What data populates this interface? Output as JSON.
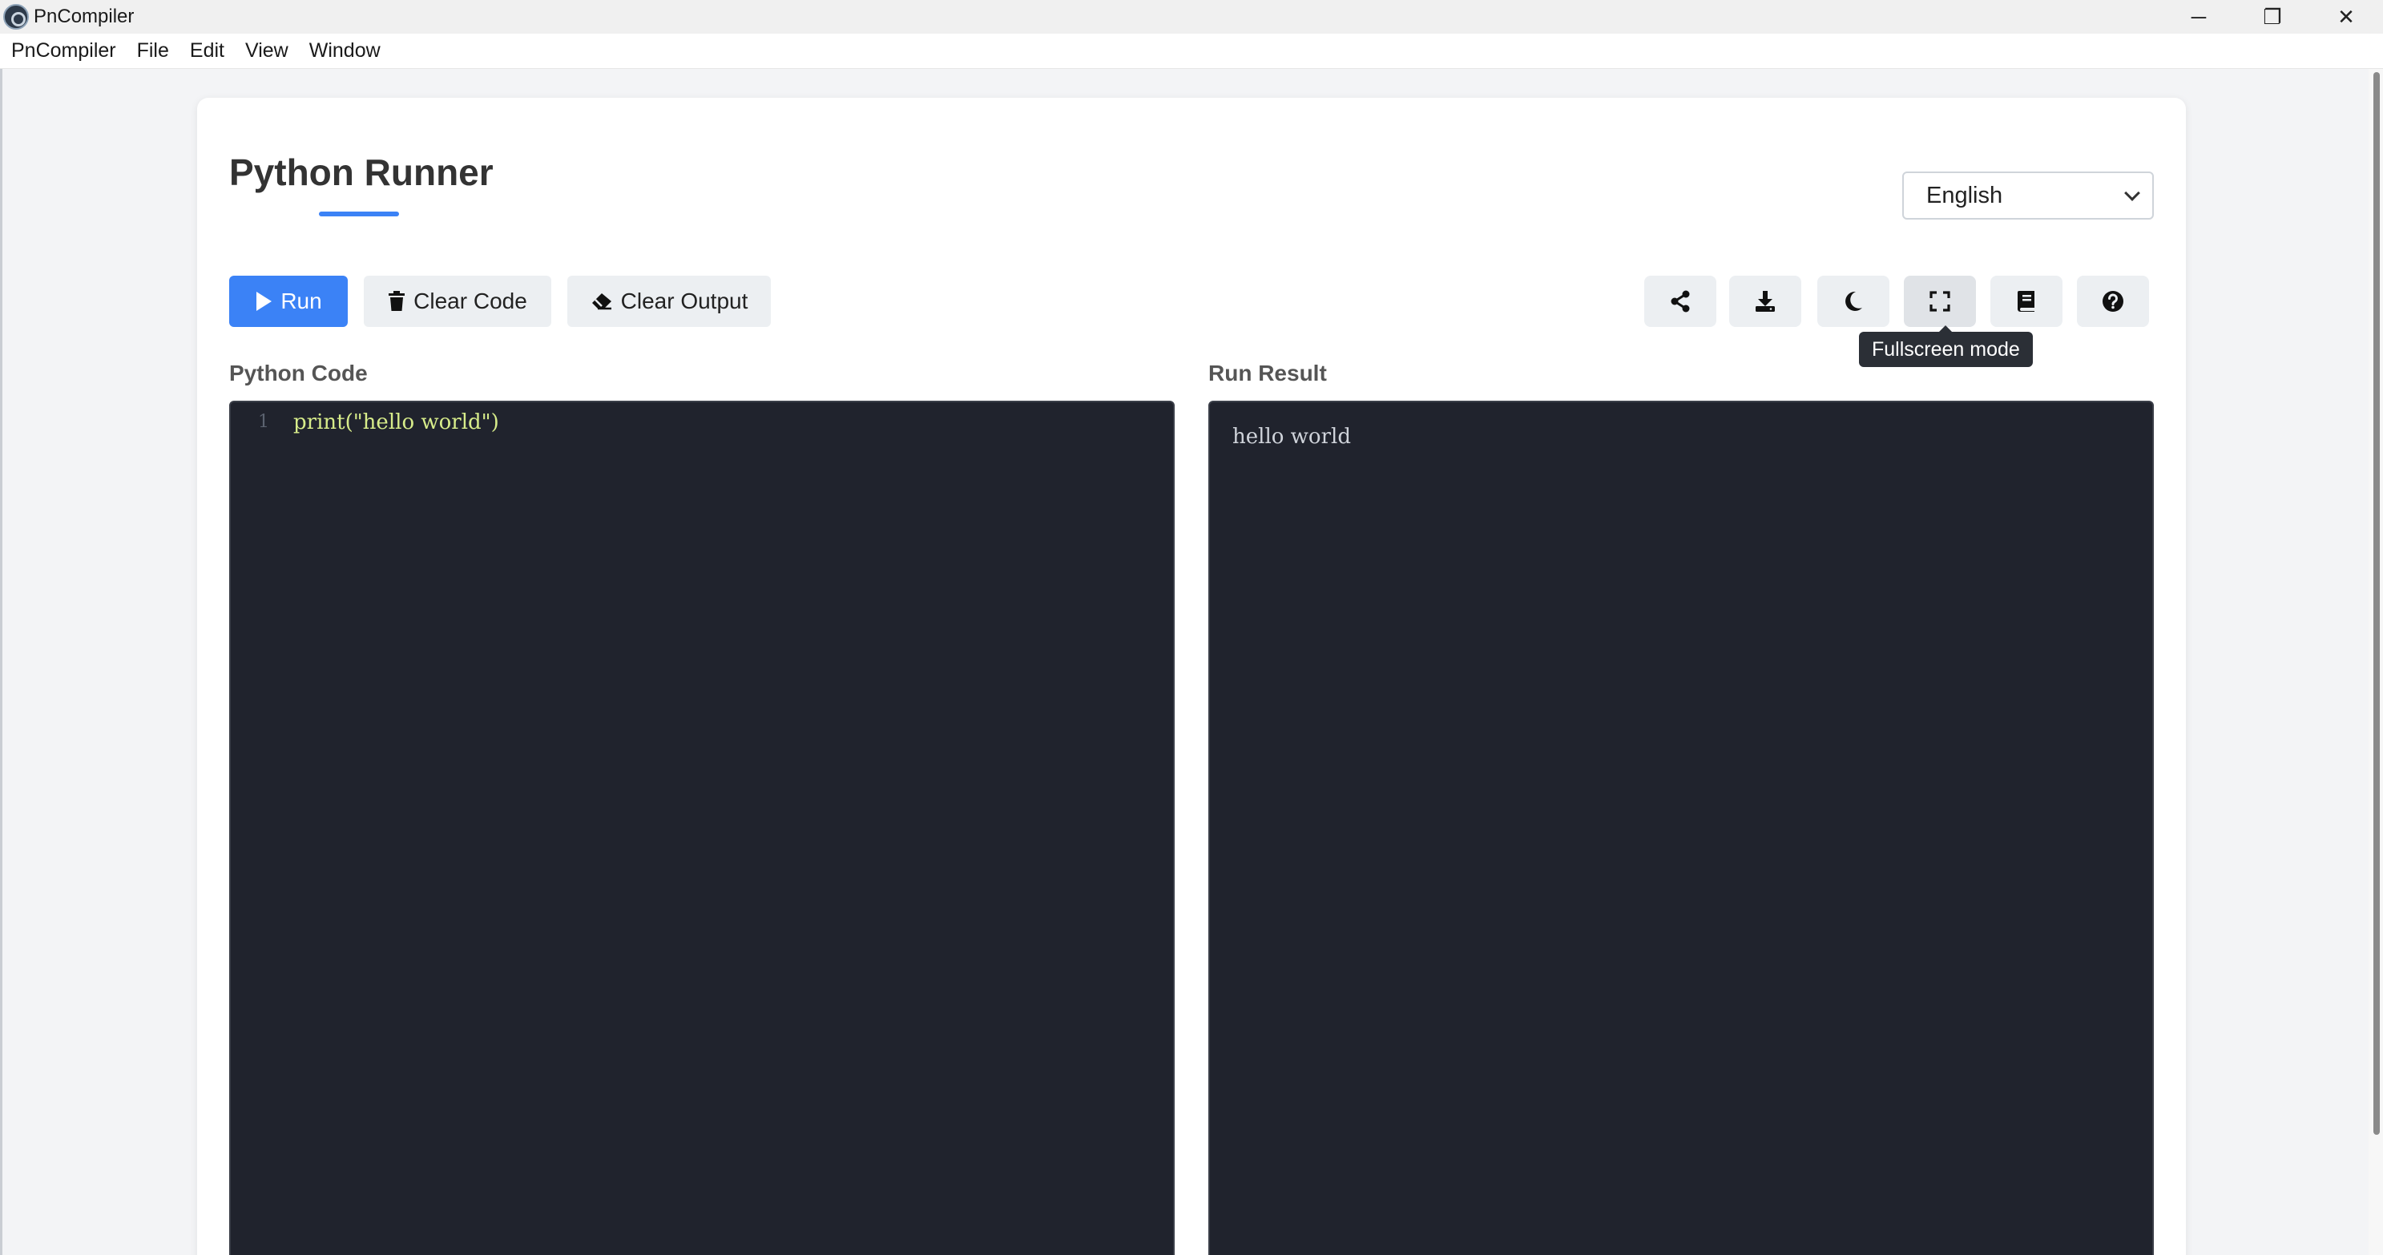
{
  "window": {
    "title": "PnCompiler",
    "controls": {
      "minimize": "─",
      "restore": "❐",
      "close": "✕"
    }
  },
  "menu": {
    "items": [
      "PnCompiler",
      "File",
      "Edit",
      "View",
      "Window"
    ]
  },
  "page": {
    "title": "Python Runner",
    "language": {
      "selected": "English"
    }
  },
  "toolbar": {
    "run_label": "Run",
    "clear_code_label": "Clear Code",
    "clear_output_label": "Clear Output",
    "tools": [
      {
        "name": "share-icon"
      },
      {
        "name": "download-icon"
      },
      {
        "name": "moon-icon"
      },
      {
        "name": "fullscreen-icon"
      },
      {
        "name": "book-icon"
      },
      {
        "name": "help-icon"
      }
    ],
    "tooltip": "Fullscreen mode"
  },
  "editor": {
    "label": "Python Code",
    "lines": [
      {
        "no": "1",
        "text": "print(\"hello world\")"
      }
    ]
  },
  "result": {
    "label": "Run Result",
    "output": "hello world"
  },
  "colors": {
    "accent": "#3b82f6",
    "editor_bg": "#20232d",
    "code_text": "#d7ec8a"
  }
}
